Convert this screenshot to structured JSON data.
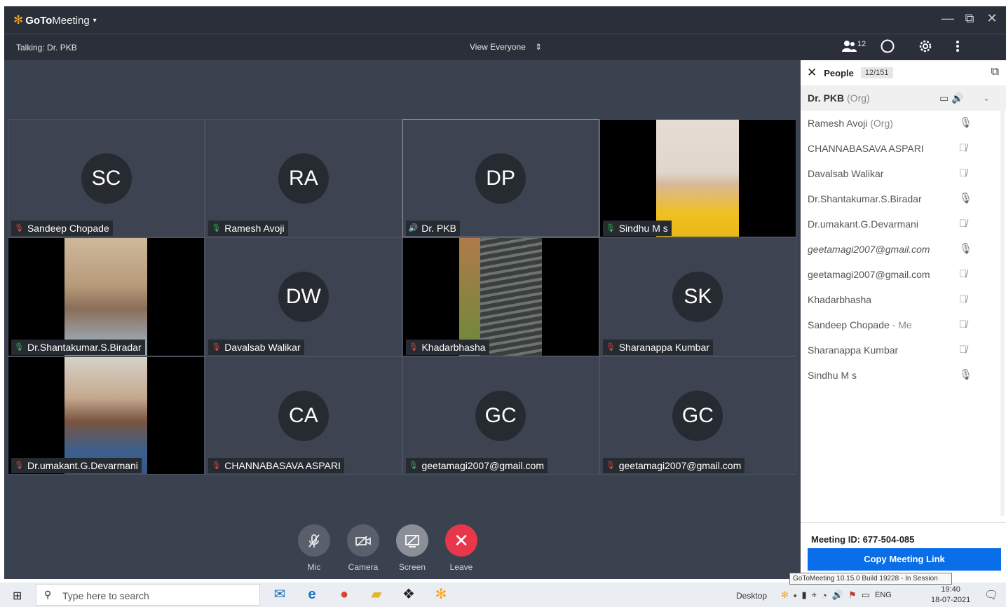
{
  "app": {
    "name_part1": "GoTo",
    "name_part2": "Meeting",
    "menu_caret": "▾",
    "minimize": "—",
    "restore": "⧉",
    "close": "✕"
  },
  "infobar": {
    "talking": "Talking: Dr. PKB",
    "view": "View Everyone",
    "view_icon": "⇕",
    "people_count": "12"
  },
  "tiles": [
    {
      "initials": "SC",
      "name": "Sandeep  Chopade",
      "mic": "muted",
      "video": false
    },
    {
      "initials": "RA",
      "name": "Ramesh Avoji",
      "mic": "on",
      "video": false
    },
    {
      "initials": "DP",
      "name": "Dr. PKB",
      "mic": "speaking",
      "video": false,
      "active": true
    },
    {
      "initials": "",
      "name": "Sindhu M s",
      "mic": "on",
      "video": true
    },
    {
      "initials": "",
      "name": "Dr.Shantakumar.S.Biradar",
      "mic": "on",
      "video": true
    },
    {
      "initials": "DW",
      "name": "Davalsab Walikar",
      "mic": "muted",
      "video": false
    },
    {
      "initials": "",
      "name": "Khadarbhasha",
      "mic": "muted",
      "video": true
    },
    {
      "initials": "SK",
      "name": "Sharanappa Kumbar",
      "mic": "muted",
      "video": false
    },
    {
      "initials": "",
      "name": "Dr.umakant.G.Devarmani",
      "mic": "muted",
      "video": true
    },
    {
      "initials": "CA",
      "name": "CHANNABASAVA ASPARI",
      "mic": "muted",
      "video": false
    },
    {
      "initials": "GC",
      "name": "geetamagi2007@gmail.com",
      "mic": "on",
      "video": false
    },
    {
      "initials": "GC",
      "name": "geetamagi2007@gmail.com",
      "mic": "muted",
      "video": false
    }
  ],
  "controls": {
    "mic": "Mic",
    "camera": "Camera",
    "screen": "Screen",
    "leave": "Leave"
  },
  "people_panel": {
    "title": "People",
    "count": "12/151",
    "rows": [
      {
        "name": "Dr. PKB",
        "tag": "(Org)",
        "mic": "organizer"
      },
      {
        "name": "Ramesh Avoji",
        "tag": "(Org)",
        "mic": "on"
      },
      {
        "name": "CHANNABASAVA ASPARI",
        "tag": "",
        "mic": "muted"
      },
      {
        "name": "Davalsab Walikar",
        "tag": "",
        "mic": "muted"
      },
      {
        "name": "Dr.Shantakumar.S.Biradar",
        "tag": "",
        "mic": "on"
      },
      {
        "name": "Dr.umakant.G.Devarmani",
        "tag": "",
        "mic": "muted"
      },
      {
        "name": "geetamagi2007@gmail.com",
        "tag": "",
        "mic": "on",
        "italic": true
      },
      {
        "name": "geetamagi2007@gmail.com",
        "tag": "",
        "mic": "muted"
      },
      {
        "name": "Khadarbhasha",
        "tag": "",
        "mic": "muted"
      },
      {
        "name": "Sandeep  Chopade",
        "tag": "- Me",
        "mic": "muted"
      },
      {
        "name": "Sharanappa Kumbar",
        "tag": "",
        "mic": "muted"
      },
      {
        "name": "Sindhu M s",
        "tag": "",
        "mic": "on"
      }
    ],
    "meeting_id": "Meeting ID: 677-504-085",
    "copy_link": "Copy Meeting Link"
  },
  "tooltip": "GoToMeeting 10.15.0 Build 19228 - In Session",
  "taskbar": {
    "search_placeholder": "Type here to search",
    "desktop": "Desktop",
    "lang": "ENG",
    "time": "19:40",
    "date": "18-07-2021"
  },
  "colors": {
    "accent": "#0a6ee8",
    "leave": "#e8374a",
    "muted_mic": "#e74c3c",
    "active_mic": "#3dbd5d",
    "brand": "#f5a623"
  }
}
